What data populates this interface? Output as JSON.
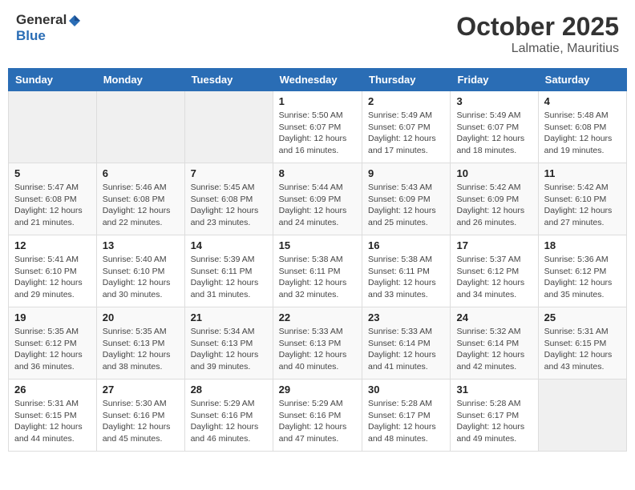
{
  "header": {
    "logo_general": "General",
    "logo_blue": "Blue",
    "month": "October 2025",
    "location": "Lalmatie, Mauritius"
  },
  "days_of_week": [
    "Sunday",
    "Monday",
    "Tuesday",
    "Wednesday",
    "Thursday",
    "Friday",
    "Saturday"
  ],
  "weeks": [
    [
      {
        "day": "",
        "sunrise": "",
        "sunset": "",
        "daylight": ""
      },
      {
        "day": "",
        "sunrise": "",
        "sunset": "",
        "daylight": ""
      },
      {
        "day": "",
        "sunrise": "",
        "sunset": "",
        "daylight": ""
      },
      {
        "day": "1",
        "sunrise": "Sunrise: 5:50 AM",
        "sunset": "Sunset: 6:07 PM",
        "daylight": "Daylight: 12 hours and 16 minutes."
      },
      {
        "day": "2",
        "sunrise": "Sunrise: 5:49 AM",
        "sunset": "Sunset: 6:07 PM",
        "daylight": "Daylight: 12 hours and 17 minutes."
      },
      {
        "day": "3",
        "sunrise": "Sunrise: 5:49 AM",
        "sunset": "Sunset: 6:07 PM",
        "daylight": "Daylight: 12 hours and 18 minutes."
      },
      {
        "day": "4",
        "sunrise": "Sunrise: 5:48 AM",
        "sunset": "Sunset: 6:08 PM",
        "daylight": "Daylight: 12 hours and 19 minutes."
      }
    ],
    [
      {
        "day": "5",
        "sunrise": "Sunrise: 5:47 AM",
        "sunset": "Sunset: 6:08 PM",
        "daylight": "Daylight: 12 hours and 21 minutes."
      },
      {
        "day": "6",
        "sunrise": "Sunrise: 5:46 AM",
        "sunset": "Sunset: 6:08 PM",
        "daylight": "Daylight: 12 hours and 22 minutes."
      },
      {
        "day": "7",
        "sunrise": "Sunrise: 5:45 AM",
        "sunset": "Sunset: 6:08 PM",
        "daylight": "Daylight: 12 hours and 23 minutes."
      },
      {
        "day": "8",
        "sunrise": "Sunrise: 5:44 AM",
        "sunset": "Sunset: 6:09 PM",
        "daylight": "Daylight: 12 hours and 24 minutes."
      },
      {
        "day": "9",
        "sunrise": "Sunrise: 5:43 AM",
        "sunset": "Sunset: 6:09 PM",
        "daylight": "Daylight: 12 hours and 25 minutes."
      },
      {
        "day": "10",
        "sunrise": "Sunrise: 5:42 AM",
        "sunset": "Sunset: 6:09 PM",
        "daylight": "Daylight: 12 hours and 26 minutes."
      },
      {
        "day": "11",
        "sunrise": "Sunrise: 5:42 AM",
        "sunset": "Sunset: 6:10 PM",
        "daylight": "Daylight: 12 hours and 27 minutes."
      }
    ],
    [
      {
        "day": "12",
        "sunrise": "Sunrise: 5:41 AM",
        "sunset": "Sunset: 6:10 PM",
        "daylight": "Daylight: 12 hours and 29 minutes."
      },
      {
        "day": "13",
        "sunrise": "Sunrise: 5:40 AM",
        "sunset": "Sunset: 6:10 PM",
        "daylight": "Daylight: 12 hours and 30 minutes."
      },
      {
        "day": "14",
        "sunrise": "Sunrise: 5:39 AM",
        "sunset": "Sunset: 6:11 PM",
        "daylight": "Daylight: 12 hours and 31 minutes."
      },
      {
        "day": "15",
        "sunrise": "Sunrise: 5:38 AM",
        "sunset": "Sunset: 6:11 PM",
        "daylight": "Daylight: 12 hours and 32 minutes."
      },
      {
        "day": "16",
        "sunrise": "Sunrise: 5:38 AM",
        "sunset": "Sunset: 6:11 PM",
        "daylight": "Daylight: 12 hours and 33 minutes."
      },
      {
        "day": "17",
        "sunrise": "Sunrise: 5:37 AM",
        "sunset": "Sunset: 6:12 PM",
        "daylight": "Daylight: 12 hours and 34 minutes."
      },
      {
        "day": "18",
        "sunrise": "Sunrise: 5:36 AM",
        "sunset": "Sunset: 6:12 PM",
        "daylight": "Daylight: 12 hours and 35 minutes."
      }
    ],
    [
      {
        "day": "19",
        "sunrise": "Sunrise: 5:35 AM",
        "sunset": "Sunset: 6:12 PM",
        "daylight": "Daylight: 12 hours and 36 minutes."
      },
      {
        "day": "20",
        "sunrise": "Sunrise: 5:35 AM",
        "sunset": "Sunset: 6:13 PM",
        "daylight": "Daylight: 12 hours and 38 minutes."
      },
      {
        "day": "21",
        "sunrise": "Sunrise: 5:34 AM",
        "sunset": "Sunset: 6:13 PM",
        "daylight": "Daylight: 12 hours and 39 minutes."
      },
      {
        "day": "22",
        "sunrise": "Sunrise: 5:33 AM",
        "sunset": "Sunset: 6:13 PM",
        "daylight": "Daylight: 12 hours and 40 minutes."
      },
      {
        "day": "23",
        "sunrise": "Sunrise: 5:33 AM",
        "sunset": "Sunset: 6:14 PM",
        "daylight": "Daylight: 12 hours and 41 minutes."
      },
      {
        "day": "24",
        "sunrise": "Sunrise: 5:32 AM",
        "sunset": "Sunset: 6:14 PM",
        "daylight": "Daylight: 12 hours and 42 minutes."
      },
      {
        "day": "25",
        "sunrise": "Sunrise: 5:31 AM",
        "sunset": "Sunset: 6:15 PM",
        "daylight": "Daylight: 12 hours and 43 minutes."
      }
    ],
    [
      {
        "day": "26",
        "sunrise": "Sunrise: 5:31 AM",
        "sunset": "Sunset: 6:15 PM",
        "daylight": "Daylight: 12 hours and 44 minutes."
      },
      {
        "day": "27",
        "sunrise": "Sunrise: 5:30 AM",
        "sunset": "Sunset: 6:16 PM",
        "daylight": "Daylight: 12 hours and 45 minutes."
      },
      {
        "day": "28",
        "sunrise": "Sunrise: 5:29 AM",
        "sunset": "Sunset: 6:16 PM",
        "daylight": "Daylight: 12 hours and 46 minutes."
      },
      {
        "day": "29",
        "sunrise": "Sunrise: 5:29 AM",
        "sunset": "Sunset: 6:16 PM",
        "daylight": "Daylight: 12 hours and 47 minutes."
      },
      {
        "day": "30",
        "sunrise": "Sunrise: 5:28 AM",
        "sunset": "Sunset: 6:17 PM",
        "daylight": "Daylight: 12 hours and 48 minutes."
      },
      {
        "day": "31",
        "sunrise": "Sunrise: 5:28 AM",
        "sunset": "Sunset: 6:17 PM",
        "daylight": "Daylight: 12 hours and 49 minutes."
      },
      {
        "day": "",
        "sunrise": "",
        "sunset": "",
        "daylight": ""
      }
    ]
  ]
}
